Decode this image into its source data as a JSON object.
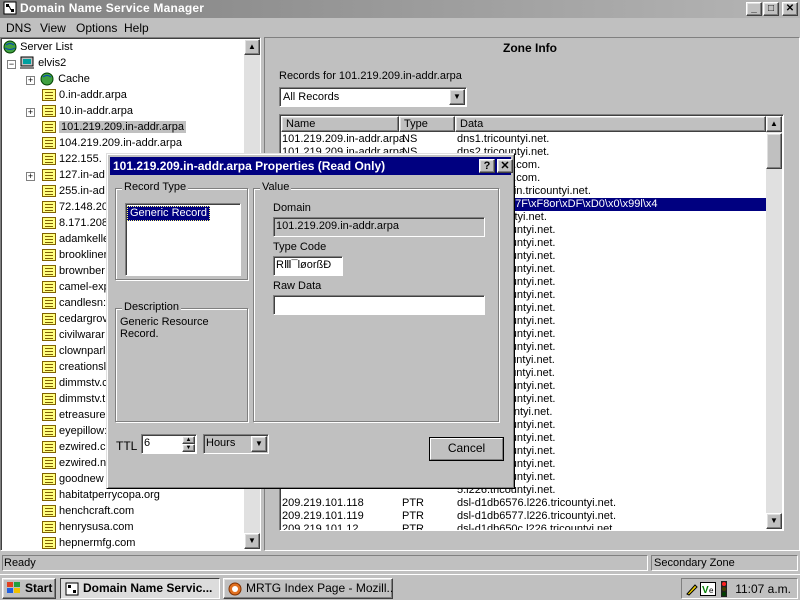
{
  "window": {
    "title": "Domain Name Service Manager",
    "controls": {
      "minimize": "_",
      "maximize": "□",
      "close": "✕"
    }
  },
  "menu": [
    {
      "label": "DNS"
    },
    {
      "label": "View"
    },
    {
      "label": "Options"
    },
    {
      "label": "Help"
    }
  ],
  "tree": {
    "root_label": "Server List",
    "server_label": "elvis2",
    "cache_label": "Cache",
    "zones": [
      "0.in-addr.arpa",
      "10.in-addr.arpa",
      "101.219.209.in-addr.arpa",
      "104.219.209.in-addr.arpa",
      "122.155.",
      "127.in-ad",
      "255.in-ad",
      "72.148.20",
      "8.171.208",
      "adamkelle",
      "brookliner",
      "brownber",
      "camel-exp",
      "candlesn:",
      "cedargrov",
      "civilwarar",
      "clownparl",
      "creationsl",
      "dimmstv.c",
      "dimmstv.t",
      "etreasure",
      "eyepillow:",
      "ezwired.c",
      "ezwired.n",
      "goodnew",
      "habitatperrycopa.org",
      "henchcraft.com",
      "henrysusa.com",
      "hepnermfg.com"
    ],
    "selected_index": 2
  },
  "zone_info": {
    "heading": "Zone Info",
    "records_for": "Records for 101.219.209.in-addr.arpa",
    "filter_value": "All Records",
    "columns": [
      "Name",
      "Type",
      "Data"
    ],
    "rows": [
      {
        "name": "101.219.209.in-addr.arpa",
        "type": "NS",
        "data": "dns1.tricountyi.net."
      },
      {
        "name": "101.219.209.in-addr.arpa",
        "type": "NS",
        "data": "dns2.tricountyi.net."
      },
      {
        "name": "",
        "type": "",
        "data": "genetworks.com."
      },
      {
        "name": "",
        "type": "",
        "data": "genetworks.com."
      },
      {
        "name": "",
        "type": "",
        "data": "yi.net., admin.tricountyi.net."
      },
      {
        "name": "",
        "type": "",
        "data": "3\\x88\\xAF\\x7F\\xF8or\\xDF\\xD0\\x0\\x99l\\x4"
      },
      {
        "name": "",
        "type": "",
        "data": "0/24.tricountyi.net."
      },
      {
        "name": "",
        "type": "",
        "data": "a.l226.tricountyi.net."
      },
      {
        "name": "",
        "type": "",
        "data": "a.l226.tricountyi.net."
      },
      {
        "name": "",
        "type": "",
        "data": "4.l226.tricountyi.net."
      },
      {
        "name": "",
        "type": "",
        "data": "5.l226.tricountyi.net."
      },
      {
        "name": "",
        "type": "",
        "data": "6.l226.tricountyi.net."
      },
      {
        "name": "",
        "type": "",
        "data": "7.l226.tricountyi.net."
      },
      {
        "name": "",
        "type": "",
        "data": "3.l226.tricountyi.net."
      },
      {
        "name": "",
        "type": "",
        "data": "3.l226.tricountyi.net."
      },
      {
        "name": "",
        "type": "",
        "data": "a.l226.tricountyi.net."
      },
      {
        "name": "",
        "type": "",
        "data": "a.l226.tricountyi.net."
      },
      {
        "name": "",
        "type": "",
        "data": "c.l226.tricountyi.net."
      },
      {
        "name": "",
        "type": "",
        "data": "c.l226.tricountyi.net."
      },
      {
        "name": "",
        "type": "",
        "data": "d.l226.tricountyi.net."
      },
      {
        "name": "",
        "type": "",
        "data": "e.l226.tricountyi.net."
      },
      {
        "name": "",
        "type": "",
        "data": "f.l226.tricountyi.net."
      },
      {
        "name": "",
        "type": "",
        "data": "0.l226.tricountyi.net."
      },
      {
        "name": "",
        "type": "",
        "data": "1.l226.tricountyi.net."
      },
      {
        "name": "",
        "type": "",
        "data": "2.l226.tricountyi.net."
      },
      {
        "name": "",
        "type": "",
        "data": "3.l226.tricountyi.net."
      },
      {
        "name": "",
        "type": "",
        "data": "4.l226.tricountyi.net."
      },
      {
        "name": "",
        "type": "",
        "data": "5.l226.tricountyi.net."
      },
      {
        "name": "209.219.101.118",
        "type": "PTR",
        "data": "dsl-d1db6576.l226.tricountyi.net."
      },
      {
        "name": "209.219.101.119",
        "type": "PTR",
        "data": "dsl-d1db6577.l226.tricountyi.net."
      },
      {
        "name": "209.219.101.12",
        "type": "PTR",
        "data": "dsl-d1db650c.l226.tricountyi.net."
      }
    ],
    "selected_row": 5
  },
  "dialog": {
    "title": "101.219.209.in-addr.arpa Properties (Read Only)",
    "help_btn": "?",
    "close_btn": "✕",
    "record_type_legend": "Record Type",
    "record_type_item": "Generic Record",
    "description_legend": "Description",
    "description_text": "Generic Resource Record.",
    "value_legend": "Value",
    "domain_label": "Domain",
    "domain_value": "101.219.209.in-addr.arpa",
    "type_code_label": "Type Code",
    "type_code_value": "RⅢ¯løorßÐ",
    "raw_data_label": "Raw Data",
    "raw_data_value": "",
    "ttl_label": "TTL",
    "ttl_value": "6",
    "ttl_unit": "Hours",
    "cancel_label": "Cancel"
  },
  "status": {
    "left": "Ready",
    "right": "Secondary Zone"
  },
  "taskbar": {
    "start_label": "Start",
    "tasks": [
      {
        "label": "Domain Name Servic...",
        "active": true
      },
      {
        "label": "MRTG Index Page - Mozill...",
        "active": false
      }
    ],
    "clock": "11:07 a.m."
  },
  "colors": {
    "selection": "#000080",
    "face": "#c0c0c0"
  }
}
